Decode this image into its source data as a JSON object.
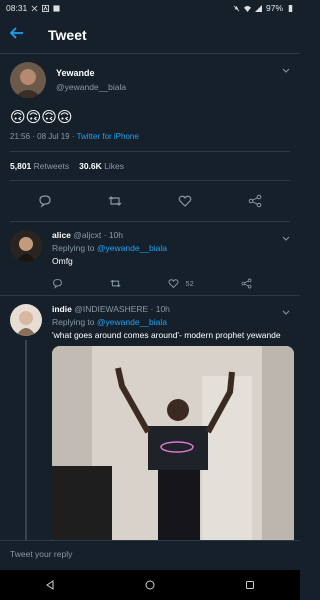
{
  "status_bar": {
    "time": "08:31",
    "battery": "97%"
  },
  "header": {
    "title": "Tweet"
  },
  "main_tweet": {
    "display_name": "Yewande",
    "handle": "@yewande__biala",
    "text": "🙃🙃🙃🙃",
    "time": "21:56 · 08 Jul 19 · ",
    "source": "Twitter for iPhone",
    "retweets_count": "5,801",
    "retweets_label": "Retweets",
    "likes_count": "30.6K",
    "likes_label": "Likes"
  },
  "replies": [
    {
      "display_name": "alice",
      "handle_time": "@aljcxt · 10h",
      "replying_prefix": "Replying to ",
      "replying_to": "@yewande__biala",
      "text": "Omfg",
      "like_count": "52"
    },
    {
      "display_name": "indie",
      "handle_time": "@INDIEWASHERE · 10h",
      "replying_prefix": "Replying to ",
      "replying_to": "@yewande__biala",
      "text": "'what goes around comes around'- modern prophet yewande"
    }
  ],
  "compose": {
    "placeholder": "Tweet your reply"
  },
  "colors": {
    "background": "#15202b",
    "accent": "#1da1f2",
    "muted": "#8899a6"
  }
}
